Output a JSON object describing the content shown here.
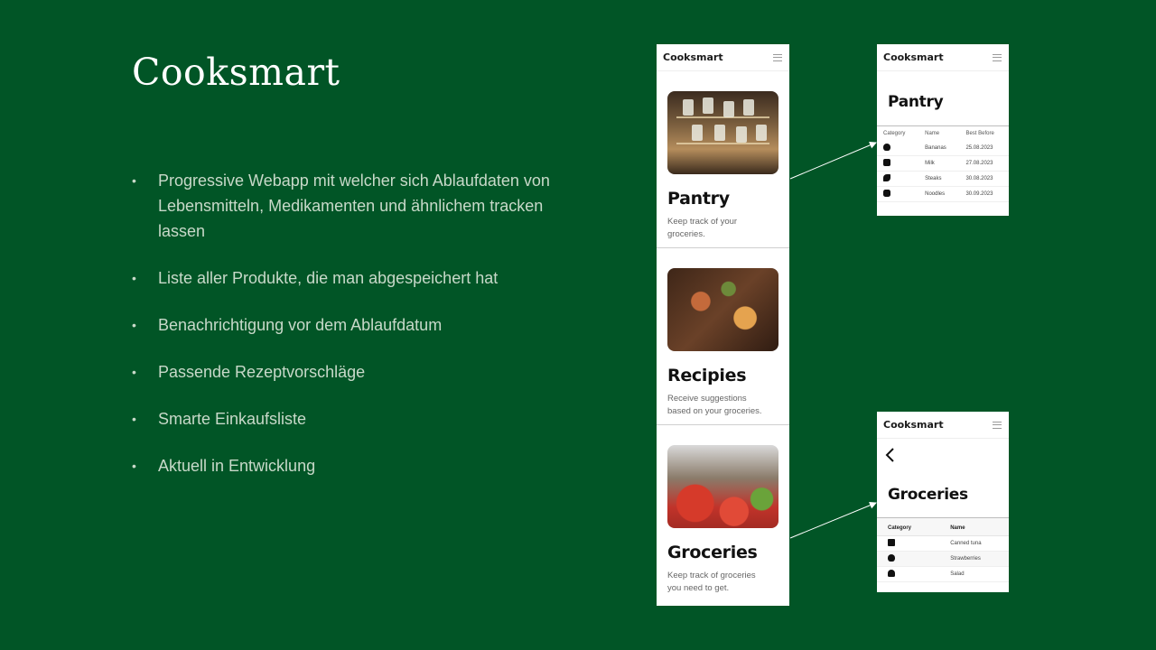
{
  "slide": {
    "title": "Cooksmart",
    "bullets": [
      "Progressive Webapp mit welcher sich Ablaufdaten von Lebensmitteln, Medikamenten und ähnlichem tracken lassen",
      "Liste aller Produkte, die man abgespeichert hat",
      "Benachrichtigung vor dem Ablaufdatum",
      "Passende Rezeptvorschläge",
      "Smarte Einkaufsliste",
      "Aktuell in Entwicklung"
    ],
    "bullet_glyph": "•"
  },
  "phone_main": {
    "app_name": "Cooksmart",
    "cards": [
      {
        "title": "Pantry",
        "desc_line1": "Keep track of your",
        "desc_line2": "groceries.",
        "image": "pantry-shelves-image"
      },
      {
        "title": "Recipies",
        "desc_line1": "Receive suggestions",
        "desc_line2": "based on your groceries.",
        "image": "food-platter-image"
      },
      {
        "title": "Groceries",
        "desc_line1": "Keep track of groceries",
        "desc_line2": "you need to get.",
        "image": "market-produce-image"
      }
    ]
  },
  "phone_pantry": {
    "app_name": "Cooksmart",
    "title": "Pantry",
    "columns": [
      "Category",
      "Name",
      "Best Before"
    ],
    "rows": [
      {
        "icon": "fruit-icon",
        "name": "Bananas",
        "date": "25.08.2023"
      },
      {
        "icon": "milk-icon",
        "name": "Milk",
        "date": "27.08.2023"
      },
      {
        "icon": "meat-icon",
        "name": "Steaks",
        "date": "30.08.2023"
      },
      {
        "icon": "grain-icon",
        "name": "Noodles",
        "date": "30.09.2023"
      }
    ]
  },
  "phone_groceries": {
    "app_name": "Cooksmart",
    "title": "Groceries",
    "columns": [
      "Category",
      "Name"
    ],
    "rows": [
      {
        "icon": "can-icon",
        "name": "Canned tuna"
      },
      {
        "icon": "fruit-icon",
        "name": "Strawberries"
      },
      {
        "icon": "vegetable-icon",
        "name": "Salad"
      }
    ]
  },
  "colors": {
    "background": "#015526",
    "title": "#ffffff",
    "bullet_text": "#c8d9c9",
    "phone_bg": "#ffffff"
  }
}
